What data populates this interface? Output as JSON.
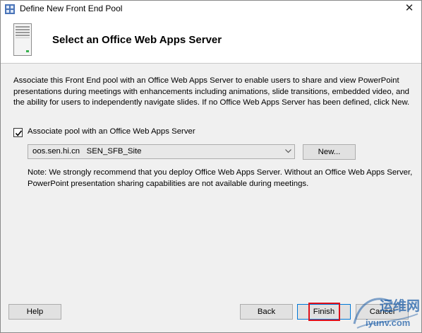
{
  "window": {
    "title": "Define New Front End Pool",
    "close_glyph": "✕"
  },
  "header": {
    "title": "Select an Office Web Apps Server",
    "icon": "server-icon"
  },
  "description": "Associate this Front End pool with an Office Web Apps Server to enable users to share and view PowerPoint presentations during meetings with enhancements including animations, slide transitions, embedded video, and the ability for users to independently navigate slides. If no Office Web Apps Server has been defined, click New.",
  "associate_checkbox": {
    "label": "Associate pool with an Office Web Apps Server",
    "checked": true
  },
  "server_select": {
    "value": "oos.sen.hi.cn   SEN_SFB_Site"
  },
  "new_button": "New...",
  "note": "Note: We strongly recommend that you deploy Office Web Apps Server. Without an Office Web Apps Server, PowerPoint presentation sharing capabilities are not available during meetings.",
  "footer": {
    "help": "Help",
    "back": "Back",
    "finish": "Finish",
    "cancel": "Cancel"
  },
  "watermark": {
    "zh": "运维网",
    "en": "iyunv.com"
  },
  "colors": {
    "highlight": "#e0101a",
    "focus_border": "#0078d7",
    "watermark": "#1f5fa8"
  }
}
